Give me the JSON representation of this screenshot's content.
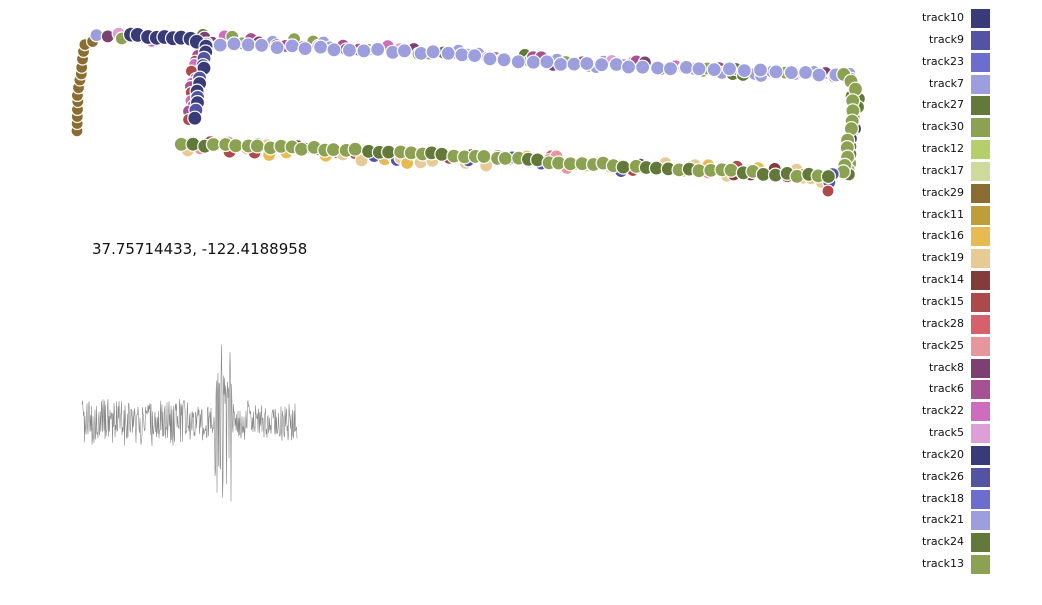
{
  "coordinate_readout": "37.75714433, -122.4188958",
  "chart_data": [
    {
      "type": "scatter",
      "title": "",
      "xlabel": "",
      "ylabel": "",
      "grid": false,
      "legend_placement": "right",
      "legend": [
        {
          "name": "track10",
          "color": "#393b79"
        },
        {
          "name": "track9",
          "color": "#5254a3"
        },
        {
          "name": "track23",
          "color": "#6b6ecf"
        },
        {
          "name": "track7",
          "color": "#9c9ede"
        },
        {
          "name": "track27",
          "color": "#637939"
        },
        {
          "name": "track30",
          "color": "#8ca252"
        },
        {
          "name": "track12",
          "color": "#b5cf6b"
        },
        {
          "name": "track17",
          "color": "#cedb9c"
        },
        {
          "name": "track29",
          "color": "#8c6d31"
        },
        {
          "name": "track11",
          "color": "#bd9e39"
        },
        {
          "name": "track16",
          "color": "#e7ba52"
        },
        {
          "name": "track19",
          "color": "#e7cb94"
        },
        {
          "name": "track14",
          "color": "#843c39"
        },
        {
          "name": "track15",
          "color": "#ad494a"
        },
        {
          "name": "track28",
          "color": "#d6616b"
        },
        {
          "name": "track25",
          "color": "#e7969c"
        },
        {
          "name": "track8",
          "color": "#7b4173"
        },
        {
          "name": "track6",
          "color": "#a55194"
        },
        {
          "name": "track22",
          "color": "#ce6dbd"
        },
        {
          "name": "track5",
          "color": "#de9ed6"
        },
        {
          "name": "track20",
          "color": "#393b79"
        },
        {
          "name": "track26",
          "color": "#5254a3"
        },
        {
          "name": "track18",
          "color": "#6b6ecf"
        },
        {
          "name": "track21",
          "color": "#9c9ede"
        },
        {
          "name": "track24",
          "color": "#637939"
        },
        {
          "name": "track13",
          "color": "#8ca252"
        }
      ]
    },
    {
      "type": "line",
      "title": "",
      "xlabel": "",
      "ylabel": "",
      "grid": false,
      "series_color": "#888888"
    }
  ]
}
